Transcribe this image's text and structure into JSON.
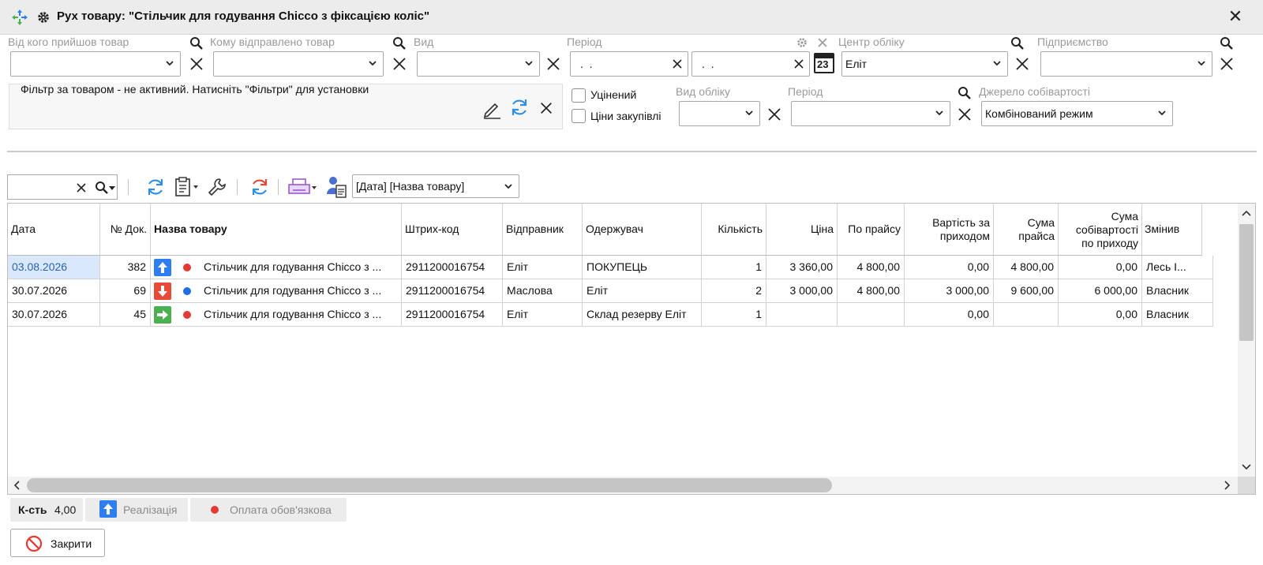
{
  "window": {
    "title": "Рух товару: \"Стільчик для годування Chicco з фіксацією коліс\""
  },
  "filters": {
    "from_label": "Від кого прийшов товар",
    "to_label": "Кому відправлено товар",
    "kind_label": "Вид",
    "period_label": "Період",
    "period_from": ".  .",
    "period_to": ".  .",
    "calendar_day": "23",
    "center_label": "Центр обліку",
    "center_value": "Еліт",
    "enterprise_label": "Підприємство",
    "product_filter_text": "Фільтр за товаром - не активний. Натисніть \"Фільтри\" для установки",
    "refined_label": "Уцінений",
    "purchase_prices_label": "Ціни закупівлі",
    "accounting_kind_label": "Вид обліку",
    "period2_label": "Період",
    "cost_source_label": "Джерело собівартості",
    "cost_source_value": "Комбінований режим"
  },
  "toolbar": {
    "sort_value": "[Дата]  [Назва товару]"
  },
  "grid": {
    "columns": [
      {
        "key": "date",
        "label": "Дата"
      },
      {
        "key": "doc",
        "label": "№ Док."
      },
      {
        "key": "name",
        "label": "Назва товару"
      },
      {
        "key": "barcode",
        "label": "Штрих-код"
      },
      {
        "key": "sender",
        "label": "Відправник"
      },
      {
        "key": "receiver",
        "label": "Одержувач"
      },
      {
        "key": "qty",
        "label": "Кількість"
      },
      {
        "key": "price",
        "label": "Ціна"
      },
      {
        "key": "list_price",
        "label": "По прайсу"
      },
      {
        "key": "cost_in_1",
        "label": "Вартість за"
      },
      {
        "key": "cost_in_2",
        "label": "приходом"
      },
      {
        "key": "sum_price_1",
        "label": "Сума"
      },
      {
        "key": "sum_price_2",
        "label": "прайса"
      },
      {
        "key": "sum_cost_1",
        "label": "Сума"
      },
      {
        "key": "sum_cost_2",
        "label": "собівартості"
      },
      {
        "key": "sum_cost_3",
        "label": "по приходу"
      },
      {
        "key": "changed",
        "label": "Змінив"
      }
    ],
    "rows": [
      {
        "date": "03.08.2026",
        "doc": "382",
        "direction": "up",
        "dot": "#e53935",
        "name": "Стільчик для годування Chicco з ...",
        "barcode": "2911200016754",
        "sender": "Еліт",
        "receiver": "ПОКУПЕЦЬ",
        "qty": "1",
        "price": "3 360,00",
        "list_price": "4 800,00",
        "cost_in": "0,00",
        "sum_price": "4 800,00",
        "sum_cost": "0,00",
        "changed": "Лесь І..."
      },
      {
        "date": "30.07.2026",
        "doc": "69",
        "direction": "down",
        "dot": "#1e6ee8",
        "name": "Стільчик для годування Chicco з ...",
        "barcode": "2911200016754",
        "sender": "Маслова",
        "receiver": "Еліт",
        "qty": "2",
        "price": "3 000,00",
        "list_price": "4 800,00",
        "cost_in": "3 000,00",
        "sum_price": "9 600,00",
        "sum_cost": "6 000,00",
        "changed": "Власник"
      },
      {
        "date": "30.07.2026",
        "doc": "45",
        "direction": "right",
        "dot": "#e53935",
        "name": "Стільчик для годування Chicco з ...",
        "barcode": "2911200016754",
        "sender": "Еліт",
        "receiver": "Склад резерву Еліт",
        "qty": "1",
        "price": "",
        "list_price": "",
        "cost_in": "0,00",
        "sum_price": "",
        "sum_cost": "0,00",
        "changed": "Власник"
      }
    ]
  },
  "status": {
    "qty_label": "К-сть",
    "qty_value": "4,00",
    "sale_label": "Реалізація",
    "payment_label": "Оплата обов'язкова"
  },
  "footer": {
    "close_label": "Закрити"
  },
  "colors": {
    "up": "#2f7ef0",
    "down": "#e84a3a",
    "right": "#4caf50",
    "selection": "#d9e9fb"
  }
}
